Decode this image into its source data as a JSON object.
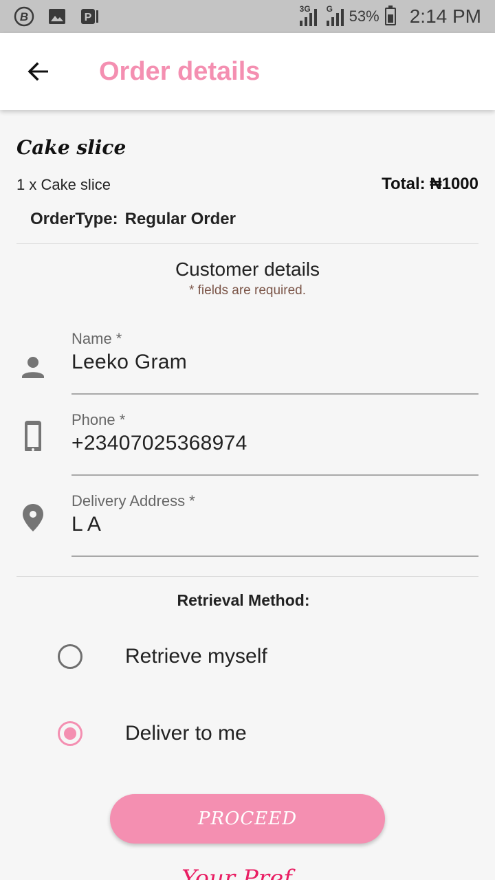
{
  "status_bar": {
    "network_3g": "3G",
    "network_g": "G",
    "battery_percent": "53%",
    "time": "2:14 PM",
    "icons": [
      "b-app-icon",
      "image-icon",
      "p-app-icon",
      "signal-icon",
      "battery-icon"
    ]
  },
  "app_bar": {
    "title": "Order details",
    "back_icon": "arrow-back-icon",
    "title_color": "#f48fb1"
  },
  "order": {
    "item_name": "Cake slice",
    "quantity_line": "1 x Cake slice",
    "total": "Total: ₦1000",
    "order_type_label": "OrderType:",
    "order_type_value": "Regular Order"
  },
  "customer": {
    "section_title": "Customer details",
    "required_note": "* fields are required.",
    "fields": [
      {
        "label": "Name *",
        "value": "Leeko Gram",
        "icon": "person-icon"
      },
      {
        "label": "Phone *",
        "value": "+23407025368974",
        "icon": "phone-icon"
      },
      {
        "label": "Delivery Address *",
        "value": "L A",
        "icon": "location-pin-icon"
      }
    ]
  },
  "retrieval": {
    "title": "Retrieval Method:",
    "options": [
      {
        "label": "Retrieve myself",
        "selected": false
      },
      {
        "label": "Deliver to me",
        "selected": true
      }
    ]
  },
  "actions": {
    "proceed_label": "PROCEED",
    "accent_color": "#f48fb1"
  },
  "footer": {
    "partial_text": "Your Pref..."
  }
}
